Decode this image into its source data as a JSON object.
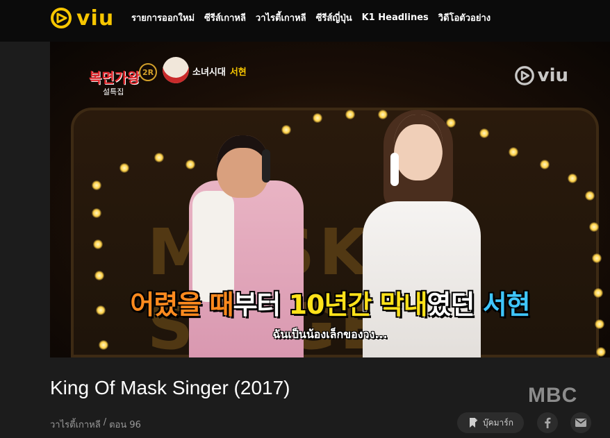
{
  "header": {
    "logo_text": "viu",
    "nav": [
      {
        "label": "รายการออกใหม่"
      },
      {
        "label": "ซีรีส์เกาหลี"
      },
      {
        "label": "วาไรตี้เกาหลี"
      },
      {
        "label": "ซีรีส์ญี่ปุ่น"
      },
      {
        "label": "K1 Headlines"
      },
      {
        "label": "วิดีโอตัวอย่าง"
      }
    ]
  },
  "player": {
    "show_logo_main": "복면가왕",
    "show_logo_sub": "설특집",
    "round_badge": "2R",
    "contestant_group": "소녀시대",
    "contestant_name": "서현",
    "watermark_text": "viu",
    "backdrop_text": "MASK SINGER",
    "subtitle_korean_parts": [
      "어렸을 때",
      "부터 ",
      "10년간 ",
      "막내",
      "였던 ",
      "서현"
    ],
    "subtitle_thai": "ฉันเป็นน้องเล็กของวง..."
  },
  "info": {
    "title": "King Of Mask Singer (2017)",
    "network": "MBC",
    "category": "วาไรตี้เกาหลี",
    "separator": "/",
    "episode": "ตอน 96",
    "bookmark_label": "บุ๊คมาร์ก"
  },
  "colors": {
    "accent": "#f7c600",
    "header_bg": "#0b0b0b",
    "page_bg": "#1c1c1c"
  }
}
